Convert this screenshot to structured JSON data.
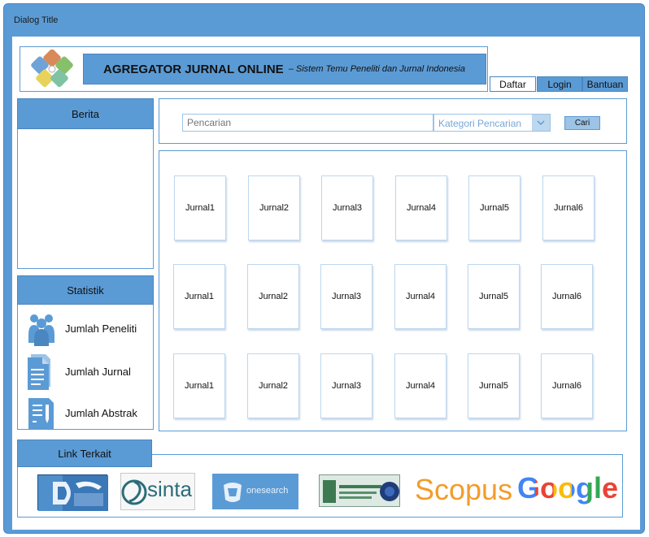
{
  "window": {
    "title": "Dialog Title"
  },
  "header": {
    "title": "AGREGATOR JURNAL ONLINE",
    "subtitle": "– Sistem Temu Peneliti dan Jurnal Indonesia",
    "tabs": [
      {
        "label": "Daftar",
        "active": true
      },
      {
        "label": "Login",
        "active": false
      },
      {
        "label": "Bantuan",
        "active": false
      }
    ]
  },
  "berita": {
    "title": "Berita"
  },
  "statistik": {
    "title": "Statistik",
    "items": [
      {
        "label": "Jumlah Peneliti",
        "icon": "people-icon"
      },
      {
        "label": "Jumlah Jurnal",
        "icon": "document-icon"
      },
      {
        "label": "Jumlah Abstrak",
        "icon": "form-icon"
      }
    ]
  },
  "search": {
    "placeholder": "Pencarian",
    "category_label": "Kategori Pencarian",
    "button_label": "Cari"
  },
  "journals": [
    [
      "Jurnal1",
      "Jurnal2",
      "Jurnal3",
      "Jurnal4",
      "Jurnal5",
      "Jurnal6"
    ],
    [
      "Jurnal1",
      "Jurnal2",
      "Jurnal3",
      "Jurnal4",
      "Jurnal5",
      "Jurnal6"
    ],
    [
      "Jurnal1",
      "Jurnal2",
      "Jurnal3",
      "Jurnal4",
      "Jurnal5",
      "Jurnal6"
    ]
  ],
  "links": {
    "title": "Link Terkait",
    "items": [
      {
        "name": "garuda-logo",
        "text": ""
      },
      {
        "name": "sinta-logo",
        "text": "sinta"
      },
      {
        "name": "onesearch-logo",
        "text": "onesearch"
      },
      {
        "name": "institution-logo",
        "text": ""
      },
      {
        "name": "scopus-logo",
        "text": "Scopus"
      },
      {
        "name": "google-scholar-logo",
        "text": "Google"
      }
    ]
  },
  "colors": {
    "accent": "#5b9bd5",
    "light_accent": "#9dc3e6",
    "scopus": "#f39c2b"
  }
}
